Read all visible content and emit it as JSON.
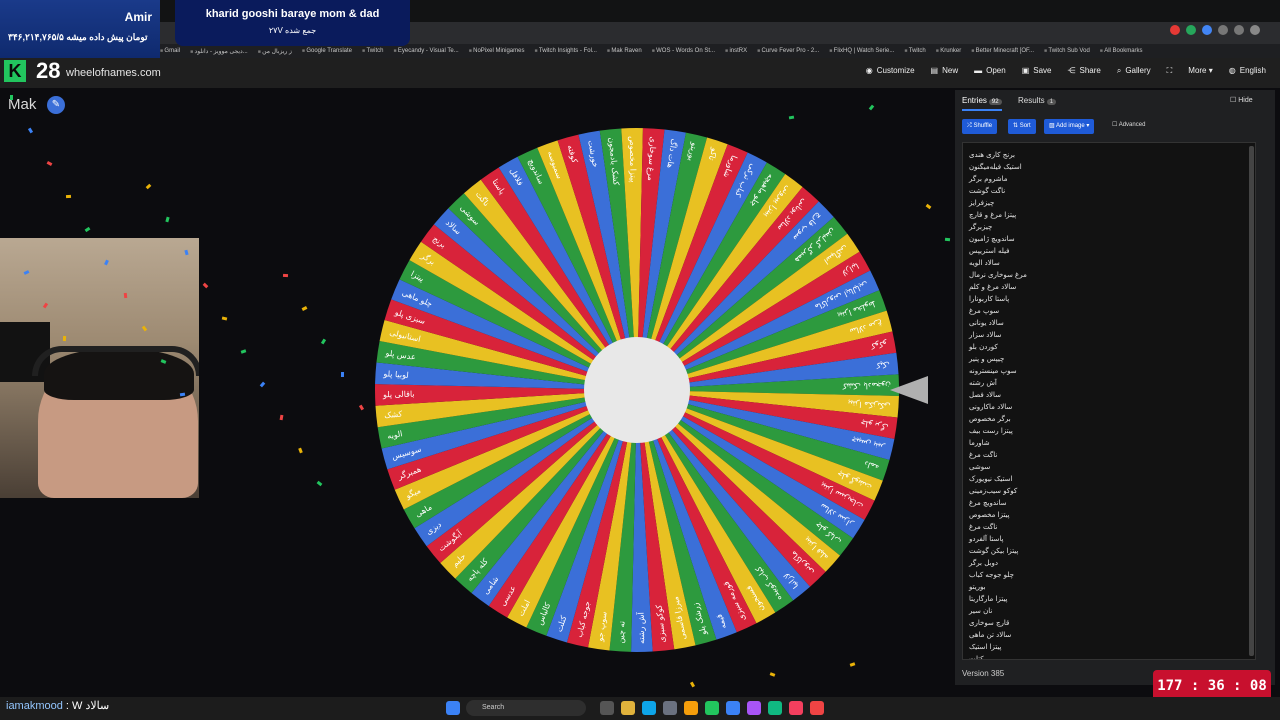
{
  "donation": {
    "name": "Amir",
    "amount": "۳۴۶,۲۱۴,۷۶۵/۵ تومان پیش داده میشه"
  },
  "stream": {
    "title": "kharid gooshi baraye mom & dad",
    "subtitle": "۲۷V جمع شده"
  },
  "bookmarks": [
    "Gmail",
    "دیجی موویز - دانلود...",
    "ز ریزبال من",
    "Google Translate",
    "Twitch",
    "Eyecandy - Visual Te...",
    "NoPixel Minigames",
    "Twitch Insights - Fol...",
    "Mak Raven",
    "WOS - Words On St...",
    "instRX",
    "Curve Fever Pro - 2...",
    "FlixHQ | Watch Serie...",
    "Twitch",
    "Krunker",
    "Better Minecraft [OF...",
    "Twitch Sub Vod",
    "All Bookmarks"
  ],
  "header": {
    "viewers": "28",
    "site": "wheelofnames.com"
  },
  "nav": [
    "Customize",
    "New",
    "Open",
    "Save",
    "Share",
    "Gallery",
    "More",
    "English"
  ],
  "wheel_title": "Mak",
  "tabs": {
    "entries": "Entries",
    "entries_count": "92",
    "results": "Results",
    "results_count": "1",
    "hide": "Hide"
  },
  "buttons": {
    "shuffle": "Shuffle",
    "sort": "Sort",
    "add_image": "Add image",
    "advanced": "Advanced"
  },
  "entries": [
    "برنج کاری هندی",
    "استیک فیله‌میگنون",
    "ماشروم برگر",
    "ناگت گوشت",
    "چیزفرایز",
    "پیتزا مرغ و قارچ",
    "چیزبرگر",
    "ساندویچ ژامبون",
    "فیله استریپس",
    "سالاد الویه",
    "مرغ سوخاری نرمال",
    "سالاد مرغ و کلم",
    "پاستا کاربونارا",
    "سوپ مرغ",
    "سالاد یونانی",
    "سالاد سزار",
    "کوردن بلو",
    "چیپس و پنیر",
    "سوپ مینسترونه",
    "آش رشته",
    "سالاد فصل",
    "سالاد ماکارونی",
    "برگر مخصوص",
    "پیتزا رست بیف",
    "شاورما",
    "ناگت مرغ",
    "سوشی",
    "استیک نیویورک",
    "کوکو سیب‌زمینی",
    "ساندویچ مرغ",
    "پیتزا مخصوص",
    "ناگت مرغ",
    "پاستا آلفردو",
    "پیتزا بیکن گوشت",
    "دوبل برگر",
    "چلو جوجه کباب",
    "بوریتو",
    "پیتزا مارگاریتا",
    "نان سیر",
    "قارچ سوخاری",
    "سالاد تن ماهی",
    "پیتزا استیک",
    "کتلت"
  ],
  "wheel_labels": [
    "کشک بادمجون",
    "پیتزا مکزیکی",
    "چلو برگ",
    "چیپس پنیر",
    "دلمه",
    "چلو گوشت",
    "پیتزا سبزیجات",
    "سالاد سزار",
    "چلو کباب",
    "پیتزا فیله",
    "ماکارونی",
    "لازانیا",
    "کباب کوبیده",
    "فسنجون",
    "قورمه سبزی",
    "قیمه",
    "زرشک پلو",
    "میرزا قاسمی",
    "کوکو سبزی",
    "آش رشته",
    "ته چین",
    "سوپ جو",
    "جوجه کباب",
    "کتلت",
    "کالباس",
    "املت",
    "عدسی",
    "شامی",
    "کله پاچه",
    "حلیم",
    "آبگوشت",
    "دیزی",
    "ماهی",
    "میگو",
    "همبرگر",
    "سوسیس",
    "الویه",
    "کشک",
    "باقالی پلو",
    "لوبیا پلو",
    "عدس پلو",
    "استانبولی",
    "سبزی پلو",
    "چلو ماهی",
    "پیتزا",
    "برگر",
    "برنج",
    "سالاد",
    "سوشی",
    "ناگت",
    "پاستا",
    "فلافل",
    "ساندویچ",
    "سمبوسه",
    "کوفته",
    "خورشت",
    "کشک بادمجون",
    "پیتزا مخصوص",
    "مرغ سوخاری",
    "هات داگ",
    "بوریتو",
    "تاکو",
    "شاورما",
    "کباب ترکی",
    "چلو ماهیچه",
    "پیتزا پپرونی",
    "سالاد یونانی",
    "سوپ قارچ",
    "همبرگر گرلیش",
    "اسپاگتی",
    "لازانیا",
    "ماکارونی ایتالیایی",
    "پیتزا مخلوط",
    "سالاد مرغ",
    "کوکو",
    "کیک"
  ],
  "wheel_colors": [
    "#2d9a3e",
    "#e8c122",
    "#d8233a",
    "#3b6fd8"
  ],
  "user_chat": {
    "who": "iamakmood",
    "text": ": W سالاد"
  },
  "version": "Version 385",
  "timer": "177 : 36 : 08",
  "taskbar": {
    "search": "Search"
  }
}
